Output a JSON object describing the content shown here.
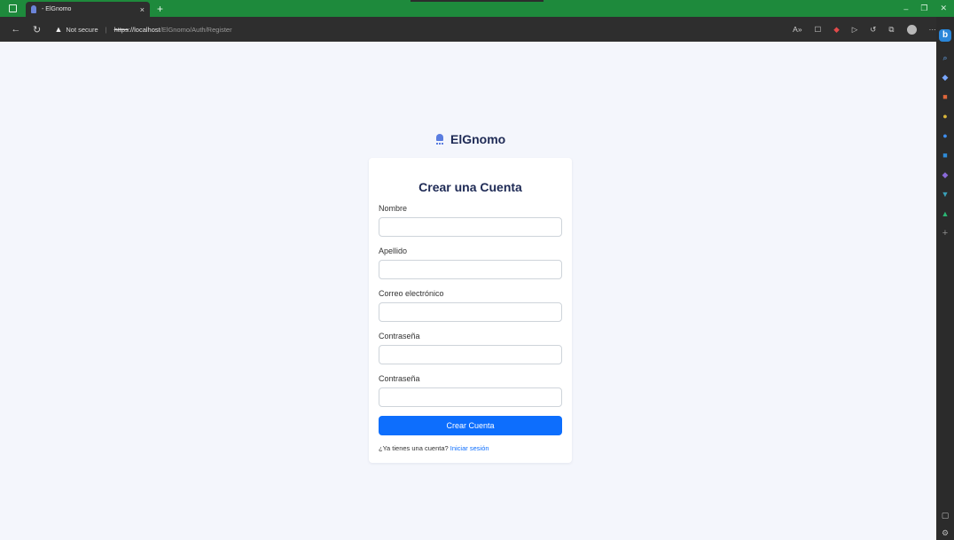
{
  "browser": {
    "tab_title": "- ElGnomo",
    "tab_close": "×",
    "new_tab": "+",
    "security_label": "Not secure",
    "url_scheme": "https",
    "url_host": "://localhost",
    "url_path": "/ElGnomo/Auth/Register",
    "more_label": "···",
    "bing_label": "b"
  },
  "page": {
    "brand": "ElGnomo",
    "title": "Crear una Cuenta",
    "fields": [
      {
        "label": "Nombre",
        "value": ""
      },
      {
        "label": "Apellido",
        "value": ""
      },
      {
        "label": "Correo electrónico",
        "value": ""
      },
      {
        "label": "Contraseña",
        "value": ""
      },
      {
        "label": "Contraseña",
        "value": ""
      }
    ],
    "submit_label": "Crear Cuenta",
    "footer_text": "¿Ya tienes una cuenta?",
    "footer_link": "Iniciar sesión"
  },
  "colors": {
    "titlebar": "#1e8a3c",
    "accent": "#0d6efd",
    "brand_text": "#1e2a55",
    "page_bg": "#f4f6fc"
  }
}
